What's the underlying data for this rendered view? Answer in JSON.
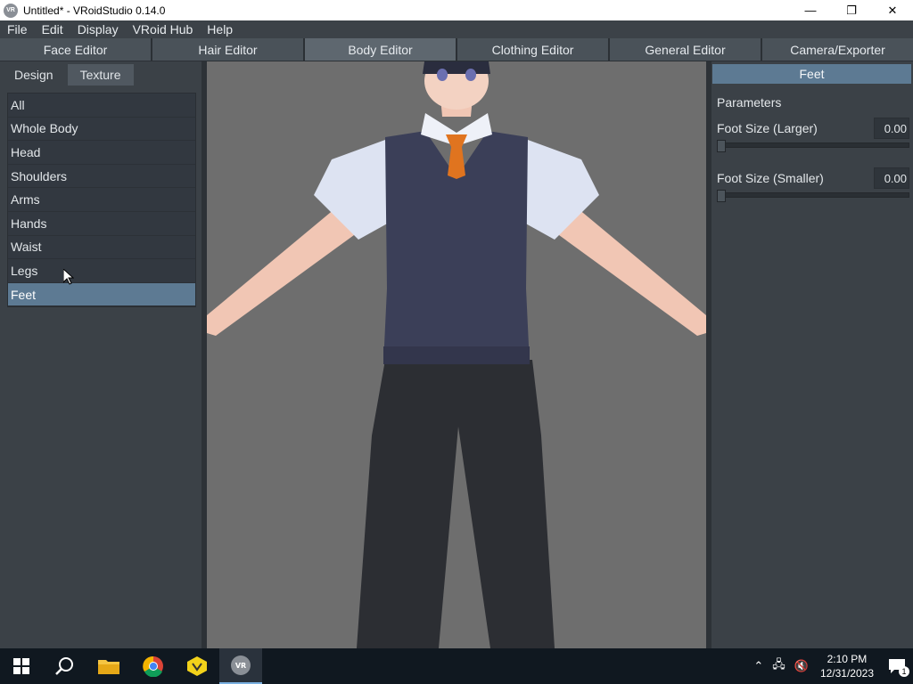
{
  "window": {
    "title": "Untitled* - VRoidStudio 0.14.0",
    "app_icon_text": "VR",
    "minimize_glyph": "—",
    "maximize_glyph": "❐",
    "close_glyph": "✕"
  },
  "menu": [
    "File",
    "Edit",
    "Display",
    "VRoid Hub",
    "Help"
  ],
  "editor_tabs": [
    "Face Editor",
    "Hair Editor",
    "Body Editor",
    "Clothing Editor",
    "General Editor",
    "Camera/Exporter"
  ],
  "active_editor_tab": "Body Editor",
  "left_panel": {
    "sub_tabs": [
      "Design",
      "Texture"
    ],
    "categories": [
      "All",
      "Whole Body",
      "Head",
      "Shoulders",
      "Arms",
      "Hands",
      "Waist",
      "Legs",
      "Feet"
    ],
    "selected_category": "Feet"
  },
  "right_panel": {
    "header": "Feet",
    "section_label": "Parameters",
    "params": [
      {
        "name": "Foot Size (Larger)",
        "value": "0.00",
        "level": 0
      },
      {
        "name": "Foot Size (Smaller)",
        "value": "0.00",
        "level": 0
      }
    ]
  },
  "taskbar": {
    "time": "2:10 PM",
    "date": "12/31/2023",
    "notification_count": "1",
    "pinned": [
      "start-icon",
      "search-icon",
      "file-explorer-icon",
      "chrome-icon",
      "vroid-hub-icon",
      "vroid-studio-icon"
    ]
  },
  "colors": {
    "accent": "#5d7a93",
    "panel": "#3b4147",
    "viewport": "#6e6e6e",
    "taskbar": "#101820"
  }
}
